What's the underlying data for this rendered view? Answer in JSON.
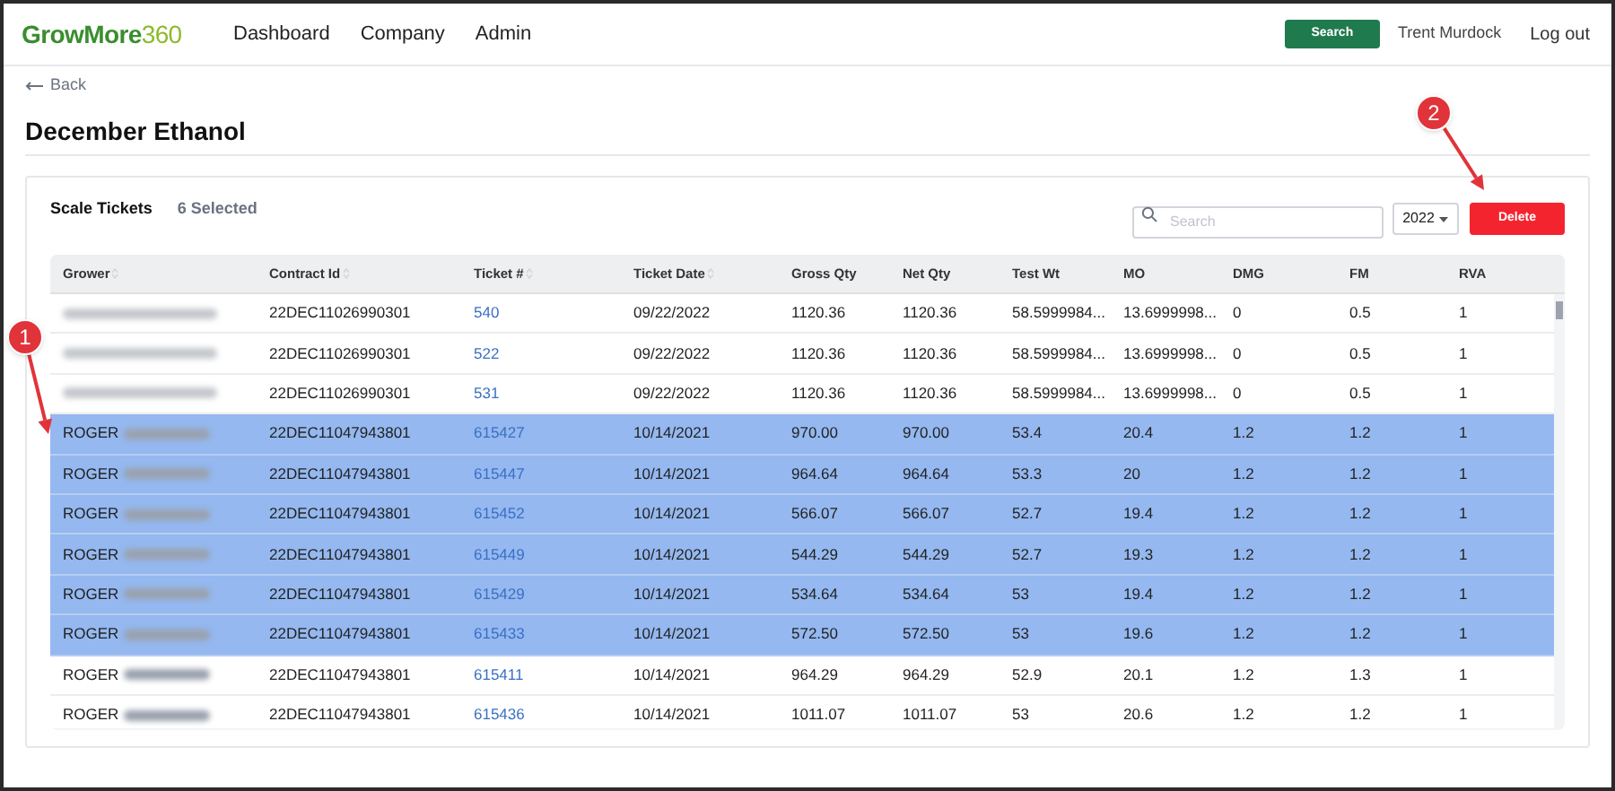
{
  "header": {
    "logo": {
      "text": "GrowMore",
      "accent": "360"
    },
    "nav": [
      {
        "label": "Dashboard"
      },
      {
        "label": "Company"
      },
      {
        "label": "Admin"
      }
    ],
    "search_button": "Search",
    "user": "Trent Murdock",
    "logout": "Log out"
  },
  "back": "Back",
  "title": "December Ethanol",
  "card": {
    "title": "Scale Tickets",
    "selected_count": "6 Selected",
    "search": {
      "placeholder": "Search"
    },
    "year": "2022",
    "delete_button": "Delete"
  },
  "table": {
    "columns": [
      {
        "label": "Grower",
        "sortable": true
      },
      {
        "label": "Contract Id",
        "sortable": true
      },
      {
        "label": "Ticket #",
        "sortable": true
      },
      {
        "label": "Ticket Date",
        "sortable": true
      },
      {
        "label": "Gross Qty",
        "sortable": false
      },
      {
        "label": "Net Qty",
        "sortable": false
      },
      {
        "label": "Test Wt",
        "sortable": false
      },
      {
        "label": "MO",
        "sortable": false
      },
      {
        "label": "DMG",
        "sortable": false
      },
      {
        "label": "FM",
        "sortable": false
      },
      {
        "label": "RVA",
        "sortable": false
      }
    ],
    "rows": [
      {
        "selected": false,
        "grower_redacted": true,
        "cells": [
          "",
          "22DEC11026990301",
          "540",
          "09/22/2022",
          "1120.36",
          "1120.36",
          "58.5999984...",
          "13.6999998...",
          "0",
          "0.5",
          "1"
        ]
      },
      {
        "selected": false,
        "grower_redacted": true,
        "cells": [
          "",
          "22DEC11026990301",
          "522",
          "09/22/2022",
          "1120.36",
          "1120.36",
          "58.5999984...",
          "13.6999998...",
          "0",
          "0.5",
          "1"
        ]
      },
      {
        "selected": false,
        "grower_redacted": true,
        "cells": [
          "",
          "22DEC11026990301",
          "531",
          "09/22/2022",
          "1120.36",
          "1120.36",
          "58.5999984...",
          "13.6999998...",
          "0",
          "0.5",
          "1"
        ]
      },
      {
        "selected": true,
        "grower_redacted": true,
        "cells": [
          "ROGER",
          "22DEC11047943801",
          "615427",
          "10/14/2021",
          "970.00",
          "970.00",
          "53.4",
          "20.4",
          "1.2",
          "1.2",
          "1"
        ]
      },
      {
        "selected": true,
        "grower_redacted": true,
        "cells": [
          "ROGER",
          "22DEC11047943801",
          "615447",
          "10/14/2021",
          "964.64",
          "964.64",
          "53.3",
          "20",
          "1.2",
          "1.2",
          "1"
        ]
      },
      {
        "selected": true,
        "grower_redacted": true,
        "cells": [
          "ROGER",
          "22DEC11047943801",
          "615452",
          "10/14/2021",
          "566.07",
          "566.07",
          "52.7",
          "19.4",
          "1.2",
          "1.2",
          "1"
        ]
      },
      {
        "selected": true,
        "grower_redacted": true,
        "cells": [
          "ROGER",
          "22DEC11047943801",
          "615449",
          "10/14/2021",
          "544.29",
          "544.29",
          "52.7",
          "19.3",
          "1.2",
          "1.2",
          "1"
        ]
      },
      {
        "selected": true,
        "grower_redacted": true,
        "cells": [
          "ROGER",
          "22DEC11047943801",
          "615429",
          "10/14/2021",
          "534.64",
          "534.64",
          "53",
          "19.4",
          "1.2",
          "1.2",
          "1"
        ]
      },
      {
        "selected": true,
        "grower_redacted": true,
        "cells": [
          "ROGER",
          "22DEC11047943801",
          "615433",
          "10/14/2021",
          "572.50",
          "572.50",
          "53",
          "19.6",
          "1.2",
          "1.2",
          "1"
        ]
      },
      {
        "selected": false,
        "grower_redacted": true,
        "cells": [
          "ROGER",
          "22DEC11047943801",
          "615411",
          "10/14/2021",
          "964.29",
          "964.29",
          "52.9",
          "20.1",
          "1.2",
          "1.3",
          "1"
        ]
      },
      {
        "selected": false,
        "grower_redacted": true,
        "cells": [
          "ROGER",
          "22DEC11047943801",
          "615436",
          "10/14/2021",
          "1011.07",
          "1011.07",
          "53",
          "20.6",
          "1.2",
          "1.2",
          "1"
        ]
      }
    ]
  },
  "annotations": [
    {
      "label": "1"
    },
    {
      "label": "2"
    }
  ]
}
